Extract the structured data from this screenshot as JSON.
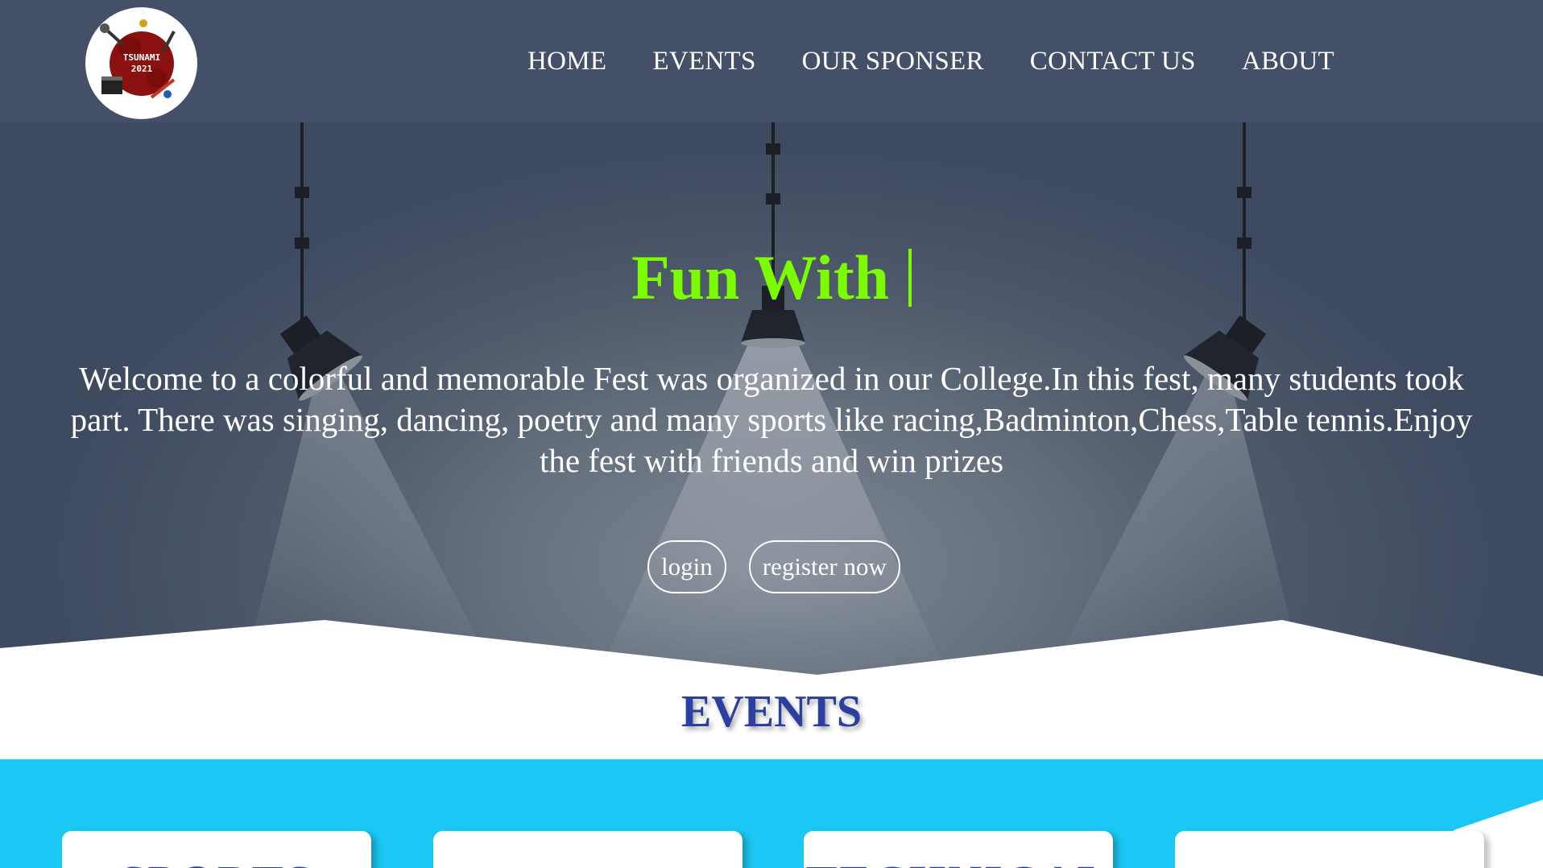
{
  "navbar": {
    "logo": {
      "line1": "TSUNAMI",
      "line2": "2021"
    },
    "links": [
      "HOME",
      "EVENTS",
      "OUR SPONSER",
      "CONTACT US",
      "ABOUT"
    ]
  },
  "hero": {
    "title": "Fun With",
    "description": "Welcome to a colorful and memorable Fest was organized in our College.In this fest, many students took part. There was singing, dancing, poetry and many sports like racing,Badminton,Chess,Table tennis.Enjoy the fest with friends and win prizes",
    "buttons": {
      "login": "login",
      "register": "register now"
    }
  },
  "events": {
    "heading": "EVENTS",
    "cards": [
      "SPORTS",
      "",
      "TECHNICAL",
      ""
    ]
  },
  "colors": {
    "navbar": "#435068",
    "title_accent": "#7cfc00",
    "events_heading": "#2b3fa0",
    "events_band": "#1bc8f3"
  }
}
